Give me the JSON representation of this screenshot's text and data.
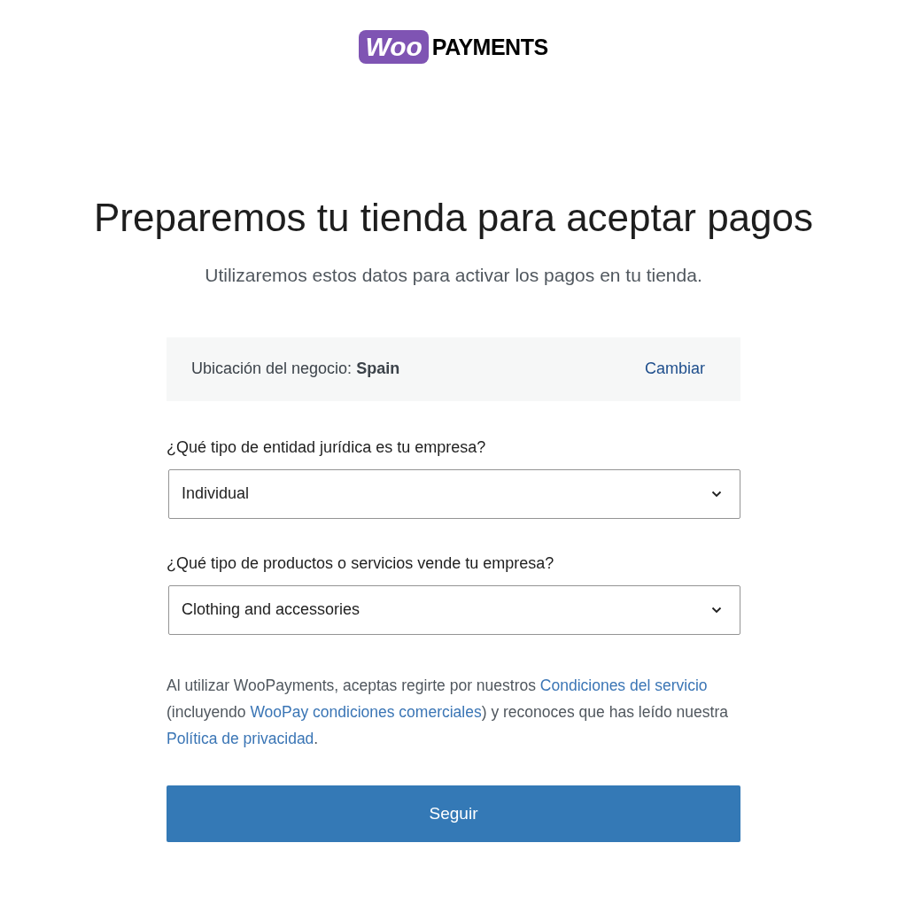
{
  "logo": {
    "badge": "Woo",
    "text": "PAYMENTS"
  },
  "title": "Preparemos tu tienda para aceptar pagos",
  "subtitle": "Utilizaremos estos datos para activar los pagos en tu tienda.",
  "location": {
    "label": "Ubicación del negocio:",
    "value": "Spain",
    "action": "Cambiar"
  },
  "fields": [
    {
      "label": "¿Qué tipo de entidad jurídica es tu empresa?",
      "value": "Individual"
    },
    {
      "label": "¿Qué tipo de productos o servicios vende tu empresa?",
      "value": "Clothing and accessories"
    }
  ],
  "terms": [
    {
      "kind": "text",
      "text": "Al utilizar WooPayments, aceptas regirte por nuestros "
    },
    {
      "kind": "link",
      "text": "Condiciones del servicio"
    },
    {
      "kind": "text",
      "text": " (incluyendo "
    },
    {
      "kind": "link",
      "text": "WooPay condiciones comerciales"
    },
    {
      "kind": "text",
      "text": ") y reconoces que has leído nuestra "
    },
    {
      "kind": "link",
      "text": "Política de privacidad"
    },
    {
      "kind": "text",
      "text": "."
    }
  ],
  "submit": "Seguir"
}
